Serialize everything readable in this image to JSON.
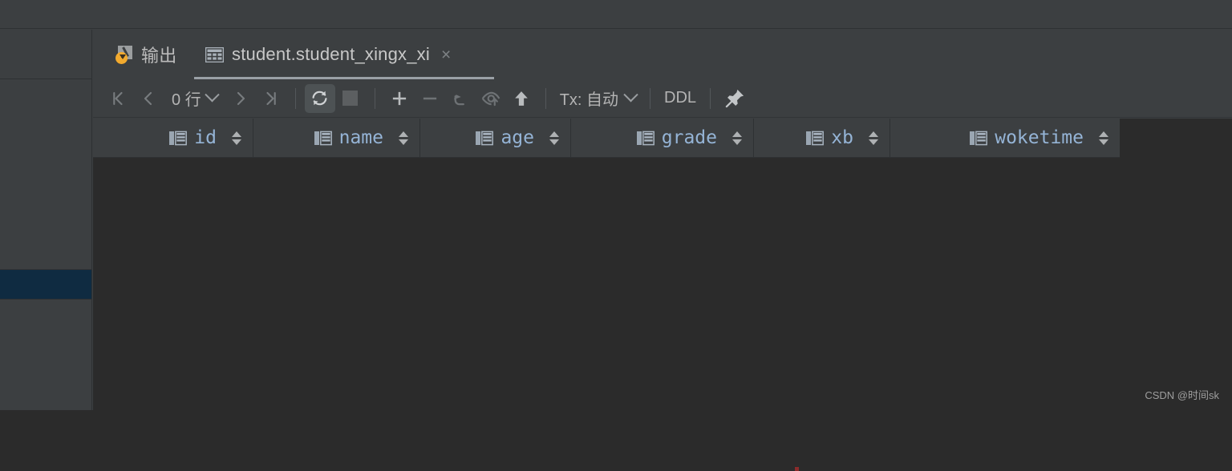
{
  "window": {
    "background": "#3c3f41",
    "data_background": "#2b2b2b",
    "accent_selected": "#0f2b41"
  },
  "sidebar": {
    "name": "left-rail",
    "selected_row_color": "#0f2b41"
  },
  "tabs": [
    {
      "id": "output",
      "label": "输出",
      "icon": "output-icon",
      "active": false,
      "closable": false
    },
    {
      "id": "table",
      "label": "student.student_xingx_xi",
      "icon": "table-grid-icon",
      "active": true,
      "closable": true,
      "close_glyph": "×"
    }
  ],
  "toolbar": {
    "first_page": "first-page-icon",
    "prev_page": "prev-page-icon",
    "row_count": "0 行",
    "row_count_dropdown": "chevron-down-icon",
    "next_page": "next-page-icon",
    "last_page": "last-page-icon",
    "refresh": "refresh-icon",
    "refresh_active": true,
    "stop": "stop-icon",
    "add_row": "plus-icon",
    "delete_row": "minus-icon",
    "revert": "revert-icon",
    "view_query": "view-query-icon",
    "submit": "submit-up-arrow-icon",
    "tx_label": "Tx: 自动",
    "tx_dropdown": "chevron-down-icon",
    "ddl_label": "DDL",
    "pin_label": "pin-icon"
  },
  "grid": {
    "columns": [
      {
        "name": "id",
        "icon": "column-key-icon",
        "sortable": true
      },
      {
        "name": "name",
        "icon": "column-key-icon",
        "sortable": true
      },
      {
        "name": "age",
        "icon": "column-key-icon",
        "sortable": true
      },
      {
        "name": "grade",
        "icon": "column-key-icon",
        "sortable": true
      },
      {
        "name": "xb",
        "icon": "column-key-icon",
        "sortable": true
      },
      {
        "name": "woketime",
        "icon": "column-key-icon",
        "sortable": true
      }
    ],
    "rows": [],
    "empty": true
  },
  "watermark": {
    "text": "CSDN @时间sk"
  }
}
